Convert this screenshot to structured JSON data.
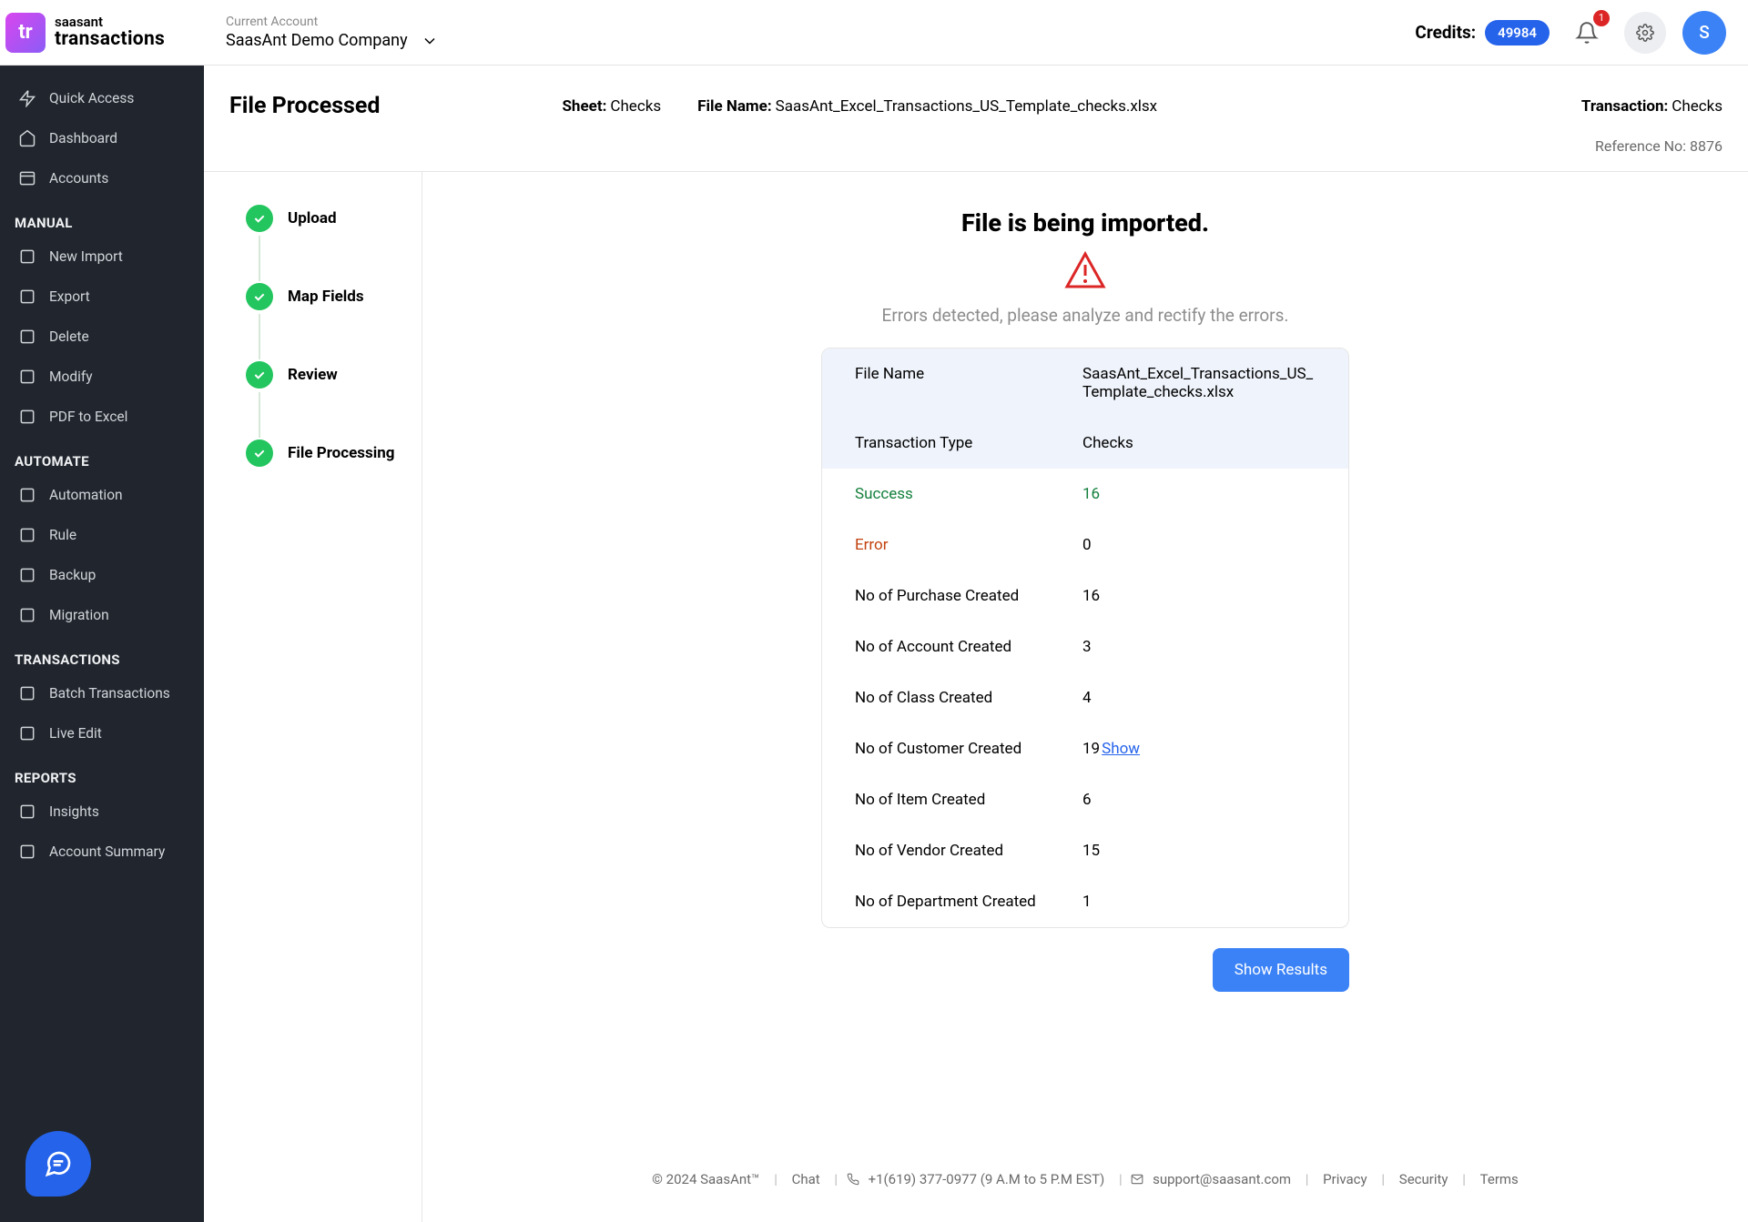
{
  "logo": {
    "mark": "tr",
    "line1": "saasant",
    "line2": "transactions"
  },
  "account": {
    "label": "Current Account",
    "name": "SaasAnt Demo Company"
  },
  "header": {
    "credits_label": "Credits:",
    "credits_value": "49984",
    "notifications": "1",
    "avatar_initial": "S"
  },
  "sidebar": {
    "top": [
      {
        "label": "Quick Access"
      },
      {
        "label": "Dashboard"
      },
      {
        "label": "Accounts"
      }
    ],
    "groups": [
      {
        "title": "MANUAL",
        "items": [
          {
            "label": "New Import"
          },
          {
            "label": "Export"
          },
          {
            "label": "Delete"
          },
          {
            "label": "Modify"
          },
          {
            "label": "PDF to Excel"
          }
        ]
      },
      {
        "title": "AUTOMATE",
        "items": [
          {
            "label": "Automation"
          },
          {
            "label": "Rule"
          },
          {
            "label": "Backup"
          },
          {
            "label": "Migration"
          }
        ]
      },
      {
        "title": "TRANSACTIONS",
        "items": [
          {
            "label": "Batch Transactions"
          },
          {
            "label": "Live Edit"
          }
        ]
      },
      {
        "title": "REPORTS",
        "items": [
          {
            "label": "Insights"
          },
          {
            "label": "Account Summary"
          }
        ]
      }
    ]
  },
  "infobar": {
    "title": "File Processed",
    "sheet_k": "Sheet:",
    "sheet_v": "Checks",
    "file_k": "File Name:",
    "file_v": "SaasAnt_Excel_Transactions_US_Template_checks.xlsx",
    "txn_k": "Transaction:",
    "txn_v": "Checks",
    "ref_k": "Reference No:",
    "ref_v": "8876"
  },
  "steps": [
    "Upload",
    "Map Fields",
    "Review",
    "File Processing"
  ],
  "panel": {
    "heading": "File is being imported.",
    "error_text": "Errors detected, please analyze and rectify the errors.",
    "rows": [
      {
        "label": "File Name",
        "value": "SaasAnt_Excel_Transactions_US_Template_checks.xlsx",
        "cls": "hhead"
      },
      {
        "label": "Transaction Type",
        "value": "Checks",
        "cls": "hhead"
      },
      {
        "label": "Success",
        "value": "16",
        "cls": "green"
      },
      {
        "label": "Error",
        "value": "0",
        "cls": "red"
      },
      {
        "label": "No of Purchase Created",
        "value": "16",
        "cls": ""
      },
      {
        "label": "No of Account Created",
        "value": "3",
        "cls": ""
      },
      {
        "label": "No of Class Created",
        "value": "4",
        "cls": ""
      },
      {
        "label": "No of Customer Created",
        "value": "19",
        "cls": "",
        "show": "Show"
      },
      {
        "label": "No of Item Created",
        "value": "6",
        "cls": ""
      },
      {
        "label": "No of Vendor Created",
        "value": "15",
        "cls": ""
      },
      {
        "label": "No of Department Created",
        "value": "1",
        "cls": ""
      }
    ],
    "show_results": "Show Results"
  },
  "footer": {
    "copyright": "© 2024 SaasAnt™",
    "chat": "Chat",
    "phone": "+1(619) 377-0977 (9 A.M to 5 P.M EST)",
    "email": "support@saasant.com",
    "privacy": "Privacy",
    "security": "Security",
    "terms": "Terms"
  }
}
